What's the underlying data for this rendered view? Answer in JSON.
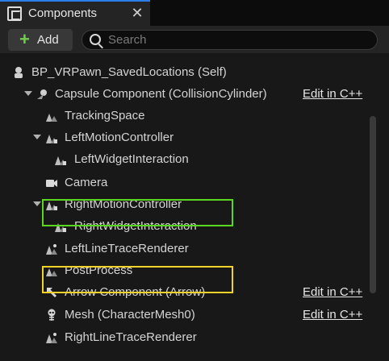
{
  "tab": {
    "title": "Components",
    "close": "✕"
  },
  "toolbar": {
    "add_label": "Add",
    "add_icon": "+",
    "search_placeholder": "Search"
  },
  "tree": {
    "edit_label": "Edit in C++",
    "rows": [
      {
        "label": "BP_VRPawn_SavedLocations (Self)",
        "icon": "pawn-icon"
      },
      {
        "label": "Capsule Component (CollisionCylinder)",
        "icon": "capsule-icon",
        "edit": true
      },
      {
        "label": "TrackingSpace",
        "icon": "scene-icon"
      },
      {
        "label": "LeftMotionController",
        "icon": "motion-controller-icon",
        "expanded": true
      },
      {
        "label": "LeftWidgetInteraction",
        "icon": "widget-interaction-icon",
        "highlight": "#5cd51d"
      },
      {
        "label": "Camera",
        "icon": "camera-icon"
      },
      {
        "label": "RightMotionController",
        "icon": "motion-controller-icon",
        "expanded": true
      },
      {
        "label": "RightWidgetInteraction",
        "icon": "widget-interaction-icon",
        "highlight": "#f2d227"
      },
      {
        "label": "LeftLineTraceRenderer",
        "icon": "line-trace-icon"
      },
      {
        "label": "PostProcess",
        "icon": "scene-icon"
      },
      {
        "label": "Arrow Component (Arrow)",
        "icon": "arrow-icon",
        "edit": true
      },
      {
        "label": "Mesh (CharacterMesh0)",
        "icon": "skeleton-icon",
        "edit": true
      },
      {
        "label": "RightLineTraceRenderer",
        "icon": "line-trace-icon"
      }
    ]
  },
  "colors": {
    "accent": "#2b7de9",
    "add": "#6fd04a",
    "highlight_green": "#5cd51d",
    "highlight_yellow": "#f2d227"
  }
}
